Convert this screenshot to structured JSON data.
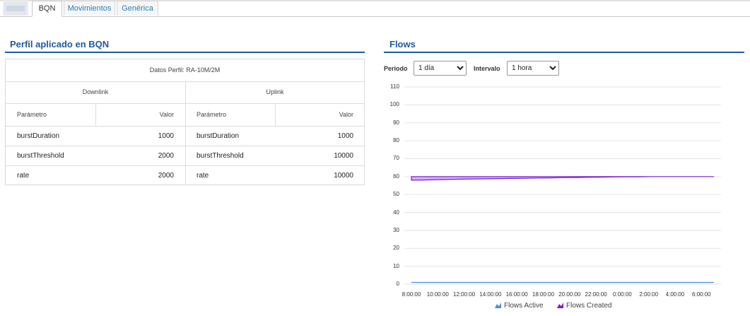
{
  "tabs": [
    {
      "label": ""
    },
    {
      "label": "BQN"
    },
    {
      "label": "Movimientos"
    },
    {
      "label": "Genérica"
    }
  ],
  "profile": {
    "title": "Perfil aplicado en BQN",
    "datos_perfil": "Datos Perfil: RA-10M/2M",
    "downlink_label": "Downlink",
    "uplink_label": "Uplink",
    "col_param": "Parámetro",
    "col_valor": "Valor",
    "rows": [
      {
        "param": "burstDuration",
        "down": "1000",
        "up": "1000"
      },
      {
        "param": "burstThreshold",
        "down": "2000",
        "up": "10000"
      },
      {
        "param": "rate",
        "down": "2000",
        "up": "10000"
      }
    ]
  },
  "flows": {
    "title": "Flows",
    "periodo_label": "Periodo",
    "periodo_value": "1 día",
    "intervalo_label": "Intervalo",
    "intervalo_value": "1 hora"
  },
  "chart_data": {
    "type": "line",
    "yticks": [
      "110",
      "100",
      "90",
      "80",
      "70",
      "60",
      "50",
      "40",
      "30",
      "20",
      "10",
      "0"
    ],
    "ylim": [
      0,
      110
    ],
    "xticks": [
      "8:00:00",
      "10:00:00",
      "12:00:00",
      "14:00:00",
      "16:00:00",
      "18:00:00",
      "20:00:00",
      "22:00:00",
      "0:00:00",
      "2:00:00",
      "4:00:00",
      "6:00:00"
    ],
    "series": [
      {
        "name": "Flows Active",
        "color": "#4a8fe0",
        "values": [
          1,
          1,
          1,
          1,
          1,
          1,
          1,
          1,
          1,
          1,
          1,
          1,
          1,
          1,
          1,
          1,
          1,
          1,
          1,
          1,
          1,
          1,
          1,
          1,
          1
        ]
      },
      {
        "name": "Flows Created",
        "color": "#7a1fd1",
        "upper": [
          60,
          60,
          60,
          60,
          60,
          60,
          60,
          60,
          60,
          60,
          60,
          60,
          60,
          60,
          60,
          60,
          60,
          60,
          60,
          60,
          60,
          60,
          60,
          60,
          60
        ],
        "lower": [
          58,
          58.1,
          58.3,
          58.4,
          58.6,
          58.7,
          58.8,
          58.9,
          59,
          59.1,
          59.2,
          59.3,
          59.4,
          59.5,
          59.6,
          59.7,
          59.8,
          59.9,
          59.9,
          60,
          60,
          60,
          60,
          60,
          60
        ]
      }
    ],
    "legend_position": "bottom",
    "grid": true
  }
}
